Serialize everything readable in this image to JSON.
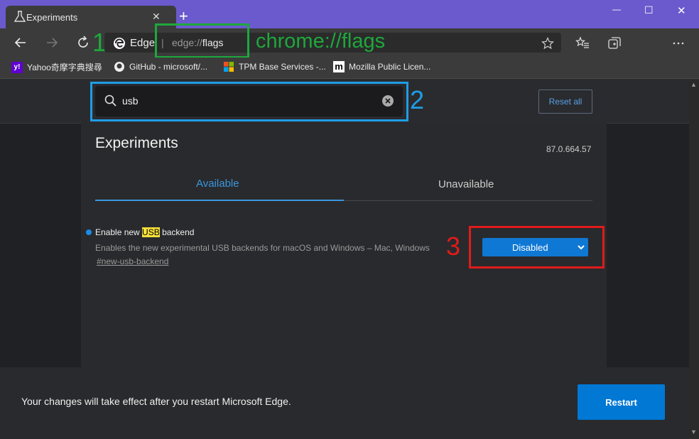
{
  "browser": {
    "tab_title": "Experiments",
    "new_tab": "+",
    "window_controls": {
      "minimize": "—",
      "maximize": "☐",
      "close": "✕"
    },
    "site_identity": "Edge",
    "address_separator": "|",
    "address_prefix": "edge://",
    "address_path": "flags",
    "bookmarks": [
      {
        "label": "Yahoo奇摩字典搜尋",
        "icon": "yahoo-icon"
      },
      {
        "label": "GitHub - microsoft/...",
        "icon": "github-icon"
      },
      {
        "label": "TPM Base Services -...",
        "icon": "windows-icon"
      },
      {
        "label": "Mozilla Public Licen...",
        "icon": "mozilla-icon"
      }
    ]
  },
  "annotations": {
    "step1": "1",
    "step1_note": "chrome://flags",
    "step2": "2",
    "step3": "3",
    "colors": {
      "green": "#1ea83c",
      "blue": "#1e9de6",
      "red": "#e01b1b"
    }
  },
  "search": {
    "value": "usb"
  },
  "header": {
    "reset_all": "Reset all",
    "title": "Experiments",
    "version": "87.0.664.57",
    "tabs": [
      {
        "label": "Available",
        "active": true
      },
      {
        "label": "Unavailable",
        "active": false
      }
    ]
  },
  "flag": {
    "name_before": "Enable new ",
    "name_highlight": "USB",
    "name_after": " backend",
    "description": "Enables the new experimental USB backends for macOS and Windows – Mac, Windows",
    "link": "#new-usb-backend",
    "state": "Disabled"
  },
  "footer": {
    "message": "Your changes will take effect after you restart Microsoft Edge.",
    "restart": "Restart"
  },
  "colors": {
    "accent": "#0078d4",
    "link_blue": "#3a96dd",
    "titlebar": "#6a5acd"
  }
}
